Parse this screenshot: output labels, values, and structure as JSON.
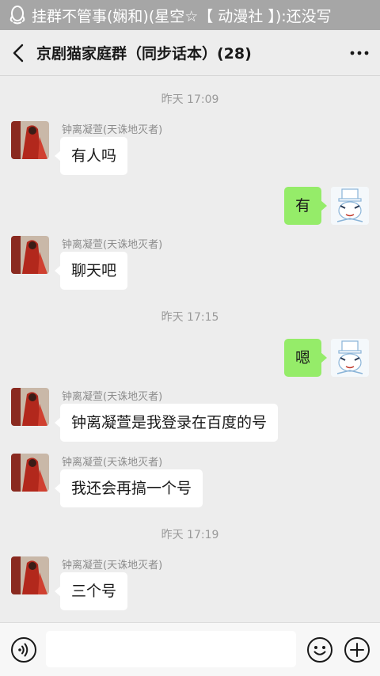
{
  "status_bar": {
    "notification_text": "挂群不管事(娴和)(星空☆【 动漫社 】):还没写"
  },
  "header": {
    "title": "京剧猫家庭群（同步话本）(28)"
  },
  "chat": {
    "timestamps": [
      "昨天 17:09",
      "昨天 17:15",
      "昨天 17:19"
    ],
    "messages": [
      {
        "side": "left",
        "sender": "钟离凝萱(天诛地灭者)",
        "text": "有人吗"
      },
      {
        "side": "right",
        "text": "有"
      },
      {
        "side": "left",
        "sender": "钟离凝萱(天诛地灭者)",
        "text": "聊天吧"
      },
      {
        "side": "right",
        "text": "嗯"
      },
      {
        "side": "left",
        "sender": "钟离凝萱(天诛地灭者)",
        "text": "钟离凝萱是我登录在百度的号"
      },
      {
        "side": "left",
        "sender": "钟离凝萱(天诛地灭者)",
        "text": "我还会再搞一个号"
      },
      {
        "side": "left",
        "sender": "钟离凝萱(天诛地灭者)",
        "text": "三个号"
      }
    ]
  },
  "input_bar": {
    "value": "",
    "icons": [
      "voice-icon",
      "emoji-icon",
      "plus-icon"
    ]
  },
  "colors": {
    "my_bubble": "#95ec69",
    "other_bubble": "#ffffff",
    "background": "#ededed"
  }
}
